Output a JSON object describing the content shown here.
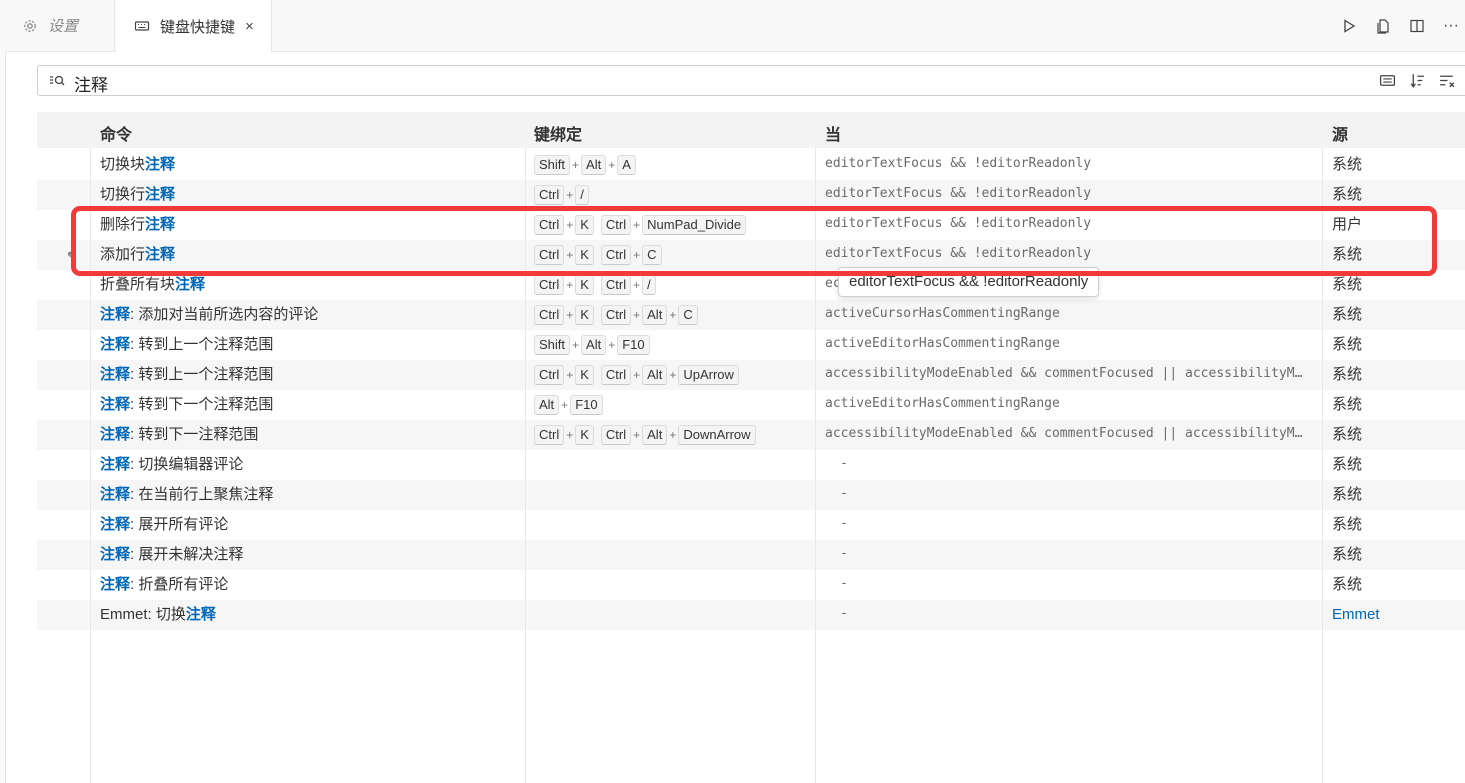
{
  "tabs": [
    {
      "label": "设置",
      "icon": "gear-icon"
    },
    {
      "label": "键盘快捷键",
      "icon": "keyboard-icon",
      "close": "×"
    }
  ],
  "search": {
    "value": "注释"
  },
  "columns": {
    "command": "命令",
    "keybinding": "键绑定",
    "when": "当",
    "source": "源"
  },
  "rows": [
    {
      "cmd_pre": "切换块",
      "cmd_hl": "注释",
      "cmd_post": "",
      "keys": [
        [
          "Shift",
          "Alt",
          "A"
        ]
      ],
      "when": "editorTextFocus && !editorReadonly",
      "source": "系统"
    },
    {
      "cmd_pre": "切换行",
      "cmd_hl": "注释",
      "cmd_post": "",
      "keys": [
        [
          "Ctrl",
          "/"
        ]
      ],
      "when": "editorTextFocus && !editorReadonly",
      "source": "系统"
    },
    {
      "cmd_pre": "删除行",
      "cmd_hl": "注释",
      "cmd_post": "",
      "keys": [
        [
          "Ctrl",
          "K"
        ],
        [
          "Ctrl",
          "NumPad_Divide"
        ]
      ],
      "when": "editorTextFocus && !editorReadonly",
      "source": "用户"
    },
    {
      "cmd_pre": "添加行",
      "cmd_hl": "注释",
      "cmd_post": "",
      "keys": [
        [
          "Ctrl",
          "K"
        ],
        [
          "Ctrl",
          "C"
        ]
      ],
      "when": "editorTextFocus && !editorReadonly",
      "source": "系统"
    },
    {
      "cmd_pre": "折叠所有块",
      "cmd_hl": "注释",
      "cmd_post": "",
      "keys": [
        [
          "Ctrl",
          "K"
        ],
        [
          "Ctrl",
          "/"
        ]
      ],
      "when": "ec",
      "source": "系统"
    },
    {
      "cmd_pre": "",
      "cmd_hl": "注释",
      "cmd_post": ": 添加对当前所选内容的评论",
      "keys": [
        [
          "Ctrl",
          "K"
        ],
        [
          "Ctrl",
          "Alt",
          "C"
        ]
      ],
      "when": "activeCursorHasCommentingRange",
      "source": "系统"
    },
    {
      "cmd_pre": "",
      "cmd_hl": "注释",
      "cmd_post": ": 转到上一个注释范围",
      "keys": [
        [
          "Shift",
          "Alt",
          "F10"
        ]
      ],
      "when": "activeEditorHasCommentingRange",
      "source": "系统"
    },
    {
      "cmd_pre": "",
      "cmd_hl": "注释",
      "cmd_post": ": 转到上一个注释范围",
      "keys": [
        [
          "Ctrl",
          "K"
        ],
        [
          "Ctrl",
          "Alt",
          "UpArrow"
        ]
      ],
      "when": "accessibilityModeEnabled && commentFocused || accessibilityM…",
      "source": "系统"
    },
    {
      "cmd_pre": "",
      "cmd_hl": "注释",
      "cmd_post": ": 转到下一个注释范围",
      "keys": [
        [
          "Alt",
          "F10"
        ]
      ],
      "when": "activeEditorHasCommentingRange",
      "source": "系统"
    },
    {
      "cmd_pre": "",
      "cmd_hl": "注释",
      "cmd_post": ": 转到下一注释范围",
      "keys": [
        [
          "Ctrl",
          "K"
        ],
        [
          "Ctrl",
          "Alt",
          "DownArrow"
        ]
      ],
      "when": "accessibilityModeEnabled && commentFocused || accessibilityM…",
      "source": "系统"
    },
    {
      "cmd_pre": "",
      "cmd_hl": "注释",
      "cmd_post": ": 切换编辑器评论",
      "keys": [],
      "when": "-",
      "source": "系统"
    },
    {
      "cmd_pre": "",
      "cmd_hl": "注释",
      "cmd_post": ": 在当前行上聚焦注释",
      "keys": [],
      "when": "-",
      "source": "系统"
    },
    {
      "cmd_pre": "",
      "cmd_hl": "注释",
      "cmd_post": ": 展开所有评论",
      "keys": [],
      "when": "-",
      "source": "系统"
    },
    {
      "cmd_pre": "",
      "cmd_hl": "注释",
      "cmd_post": ": 展开未解决注释",
      "keys": [],
      "when": "-",
      "source": "系统"
    },
    {
      "cmd_pre": "",
      "cmd_hl": "注释",
      "cmd_post": ": 折叠所有评论",
      "keys": [],
      "when": "-",
      "source": "系统"
    },
    {
      "cmd_pre": "Emmet: 切换",
      "cmd_hl": "注释",
      "cmd_post": "",
      "keys": [],
      "when": "-",
      "source": "Emmet",
      "source_link": true
    }
  ],
  "tooltip": "editorTextFocus && !editorReadonly",
  "colors": {
    "highlight": "#0066b8",
    "annotation_box": "#f23a3a"
  },
  "icons": [
    "gear-icon",
    "keyboard-icon",
    "close-icon",
    "run-icon",
    "open-json-icon",
    "split-editor-icon",
    "more-icon",
    "search-icon",
    "record-keys-icon",
    "sort-precedence-icon",
    "clear-input-icon",
    "edit-icon"
  ]
}
